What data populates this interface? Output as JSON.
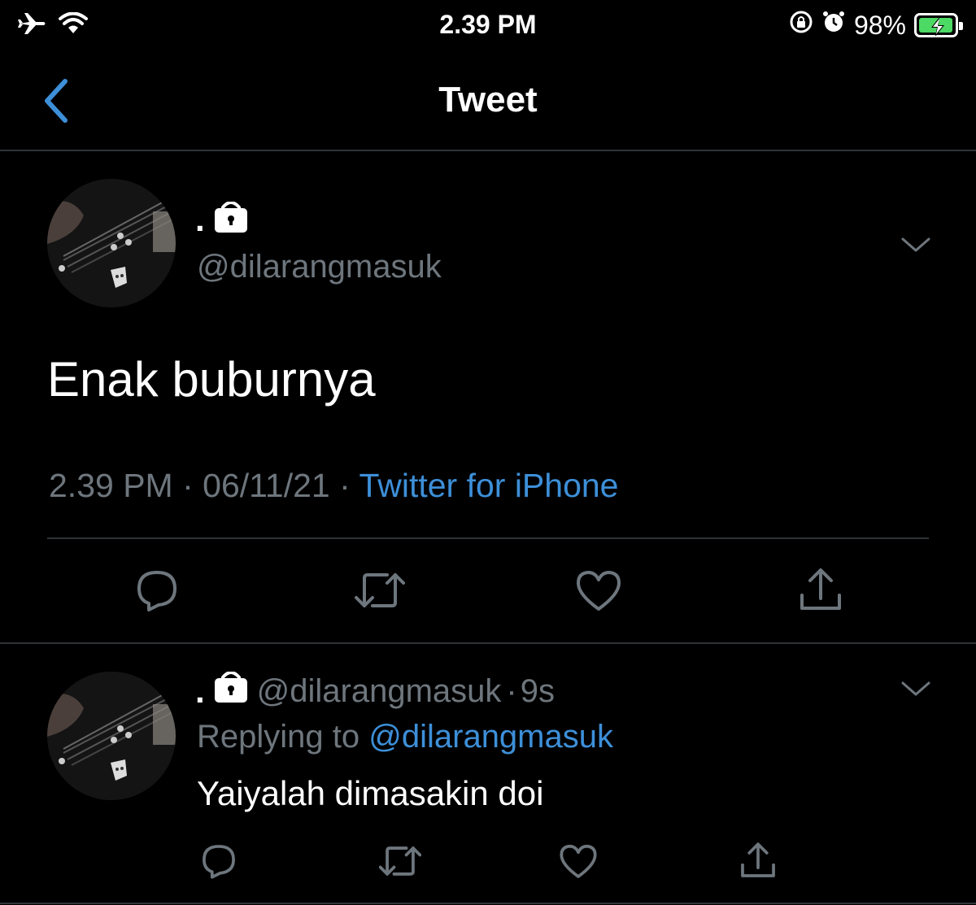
{
  "status_bar": {
    "time": "2.39 PM",
    "battery": "98%",
    "battery_level": 0.98,
    "icons": [
      "airplane-icon",
      "wifi-icon",
      "rotation-lock-icon",
      "alarm-icon",
      "battery-icon"
    ]
  },
  "nav": {
    "title": "Tweet",
    "back_icon": "chevron-left-icon"
  },
  "tweet": {
    "display_name": ".",
    "lock_icon": "lock-icon",
    "handle": "@dilarangmasuk",
    "text": "Enak buburnya",
    "time": "2.39 PM",
    "date": "06/11/21",
    "separator": "·",
    "source": "Twitter for iPhone",
    "actions": [
      "reply-icon",
      "retweet-icon",
      "like-icon",
      "share-icon"
    ]
  },
  "reply": {
    "display_name": ".",
    "handle": "@dilarangmasuk",
    "separator": "·",
    "age": "9s",
    "replying_prefix": "Replying to",
    "replying_handle": "@dilarangmasuk",
    "text": "Yaiyalah dimasakin doi",
    "actions": [
      "reply-icon",
      "retweet-icon",
      "like-icon",
      "share-icon"
    ]
  },
  "colors": {
    "background": "#000000",
    "accent": "#3d8fd8",
    "secondary_text": "#6e767d",
    "divider": "#2f3336",
    "battery_green": "#4cd964"
  }
}
